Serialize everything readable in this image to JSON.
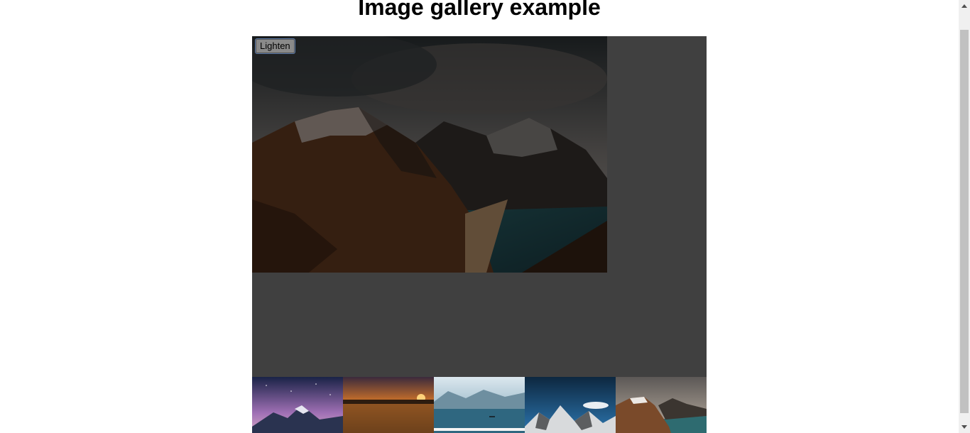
{
  "page": {
    "title": "Image gallery example"
  },
  "gallery": {
    "main_image": "mountain-fjord-photo",
    "overlay_color": "rgba(0,0,0,0.5)",
    "button_label": "Lighten",
    "thumbnails": [
      {
        "name": "milky-way-mountains-photo"
      },
      {
        "name": "sunset-lake-photo"
      },
      {
        "name": "lake-boat-photo"
      },
      {
        "name": "snowy-peaks-blue-sky-photo"
      },
      {
        "name": "mountain-fjord-photo"
      }
    ]
  },
  "colors": {
    "background": "#ffffff",
    "frame": "#808080",
    "button_bg": "#8a8a8a",
    "scrollbar_track": "#f0f0f0",
    "scrollbar_thumb": "#c1c1c1"
  }
}
